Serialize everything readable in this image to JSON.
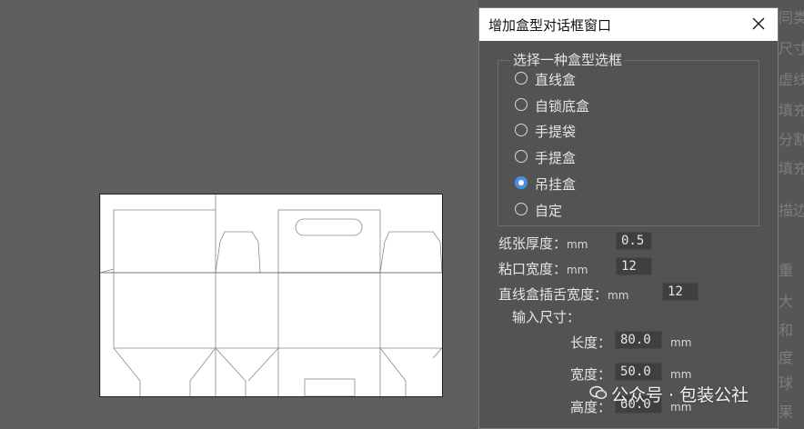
{
  "dialog": {
    "title": "增加盒型对话框窗口",
    "group_title": "选择一种盒型选框",
    "options": [
      "直线盒",
      "自锁底盒",
      "手提袋",
      "手提盒",
      "吊挂盒",
      "自定"
    ],
    "selected": "吊挂盒",
    "paper_thickness": {
      "label": "纸张厚度：",
      "unit": "mm",
      "value": "0.5"
    },
    "glue_width": {
      "label": "粘口宽度：",
      "unit": "mm",
      "value": "12"
    },
    "tuck_width": {
      "label": "直线盒插舌宽度：",
      "unit": "mm",
      "value": "12"
    },
    "size_title": "输入尺寸：",
    "length": {
      "label": "长度：",
      "value": "80.0",
      "unit": "mm"
    },
    "width": {
      "label": "宽度：",
      "value": "50.0",
      "unit": "mm"
    },
    "height": {
      "label": "高度：",
      "value": "60.0",
      "unit": "mm"
    }
  },
  "background_fragments": [
    "同类",
    "尺寸",
    "虚线",
    "填充",
    "分割",
    "填充",
    "描边",
    "重",
    "大",
    "和",
    "度",
    "球",
    "果"
  ],
  "watermark": "公众号 · 包装公社",
  "colors": {
    "accent": "#4a90e2",
    "app_bg": "#5f5f5f",
    "dialog_bg": "#535353"
  }
}
